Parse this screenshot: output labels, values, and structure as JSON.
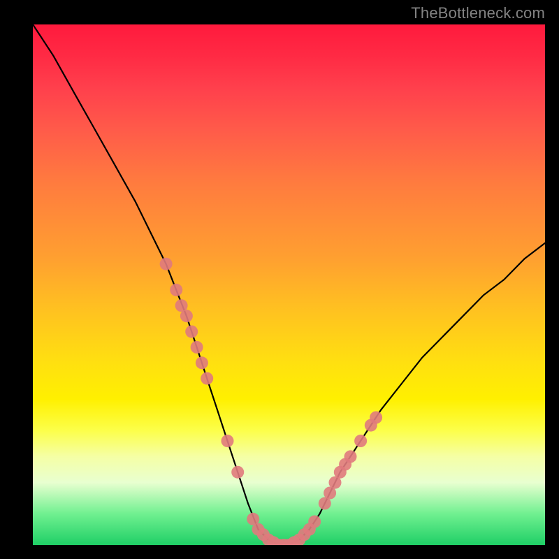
{
  "watermark": "TheBottleneck.com",
  "chart_data": {
    "type": "line",
    "title": "",
    "xlabel": "",
    "ylabel": "",
    "ylim": [
      0,
      100
    ],
    "xlim": [
      0,
      100
    ],
    "series": [
      {
        "name": "bottleneck-curve",
        "x": [
          0,
          4,
          8,
          12,
          16,
          20,
          24,
          26,
          28,
          30,
          32,
          34,
          36,
          38,
          40,
          42,
          44,
          46,
          48,
          50,
          52,
          54,
          56,
          58,
          60,
          64,
          68,
          72,
          76,
          80,
          84,
          88,
          92,
          96,
          100
        ],
        "values": [
          100,
          94,
          87,
          80,
          73,
          66,
          58,
          54,
          49,
          44,
          38,
          32,
          26,
          20,
          14,
          8,
          3,
          1,
          0,
          0,
          1,
          3,
          6,
          10,
          14,
          20,
          26,
          31,
          36,
          40,
          44,
          48,
          51,
          55,
          58
        ]
      }
    ],
    "markers": {
      "name": "highlighted-points",
      "color": "#e07a7d",
      "points": [
        {
          "x": 26,
          "y": 54
        },
        {
          "x": 28,
          "y": 49
        },
        {
          "x": 29,
          "y": 46
        },
        {
          "x": 30,
          "y": 44
        },
        {
          "x": 31,
          "y": 41
        },
        {
          "x": 32,
          "y": 38
        },
        {
          "x": 33,
          "y": 35
        },
        {
          "x": 34,
          "y": 32
        },
        {
          "x": 38,
          "y": 20
        },
        {
          "x": 40,
          "y": 14
        },
        {
          "x": 43,
          "y": 5
        },
        {
          "x": 44,
          "y": 3
        },
        {
          "x": 45,
          "y": 2
        },
        {
          "x": 46,
          "y": 1
        },
        {
          "x": 47,
          "y": 0.5
        },
        {
          "x": 48,
          "y": 0
        },
        {
          "x": 49,
          "y": 0
        },
        {
          "x": 50,
          "y": 0
        },
        {
          "x": 51,
          "y": 0.5
        },
        {
          "x": 52,
          "y": 1
        },
        {
          "x": 53,
          "y": 2
        },
        {
          "x": 54,
          "y": 3
        },
        {
          "x": 55,
          "y": 4.5
        },
        {
          "x": 57,
          "y": 8
        },
        {
          "x": 58,
          "y": 10
        },
        {
          "x": 59,
          "y": 12
        },
        {
          "x": 60,
          "y": 14
        },
        {
          "x": 61,
          "y": 15.5
        },
        {
          "x": 62,
          "y": 17
        },
        {
          "x": 64,
          "y": 20
        },
        {
          "x": 66,
          "y": 23
        },
        {
          "x": 67,
          "y": 24.5
        }
      ]
    }
  }
}
